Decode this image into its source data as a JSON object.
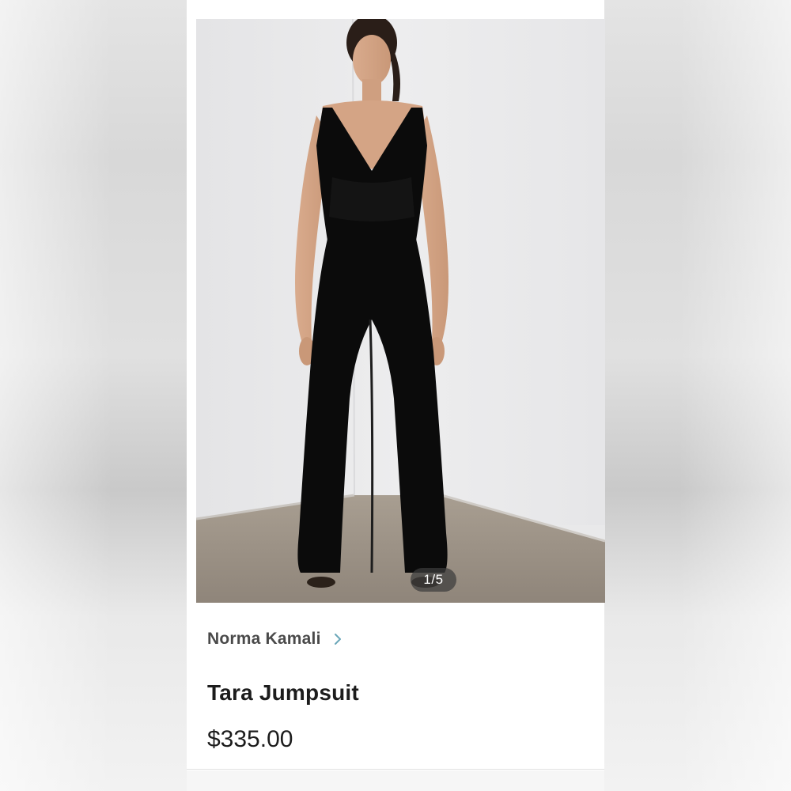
{
  "listing": {
    "image_counter": "1/5",
    "brand": "Norma Kamali",
    "title": "Tara Jumpsuit",
    "price": "$335.00"
  },
  "icons": {
    "brand_link": "chevron-right-icon"
  },
  "colors": {
    "chevron": "#6aa6b8",
    "garment": "#0b0b0b",
    "wall": "#e9e9ea",
    "floor": "#9d9285"
  }
}
